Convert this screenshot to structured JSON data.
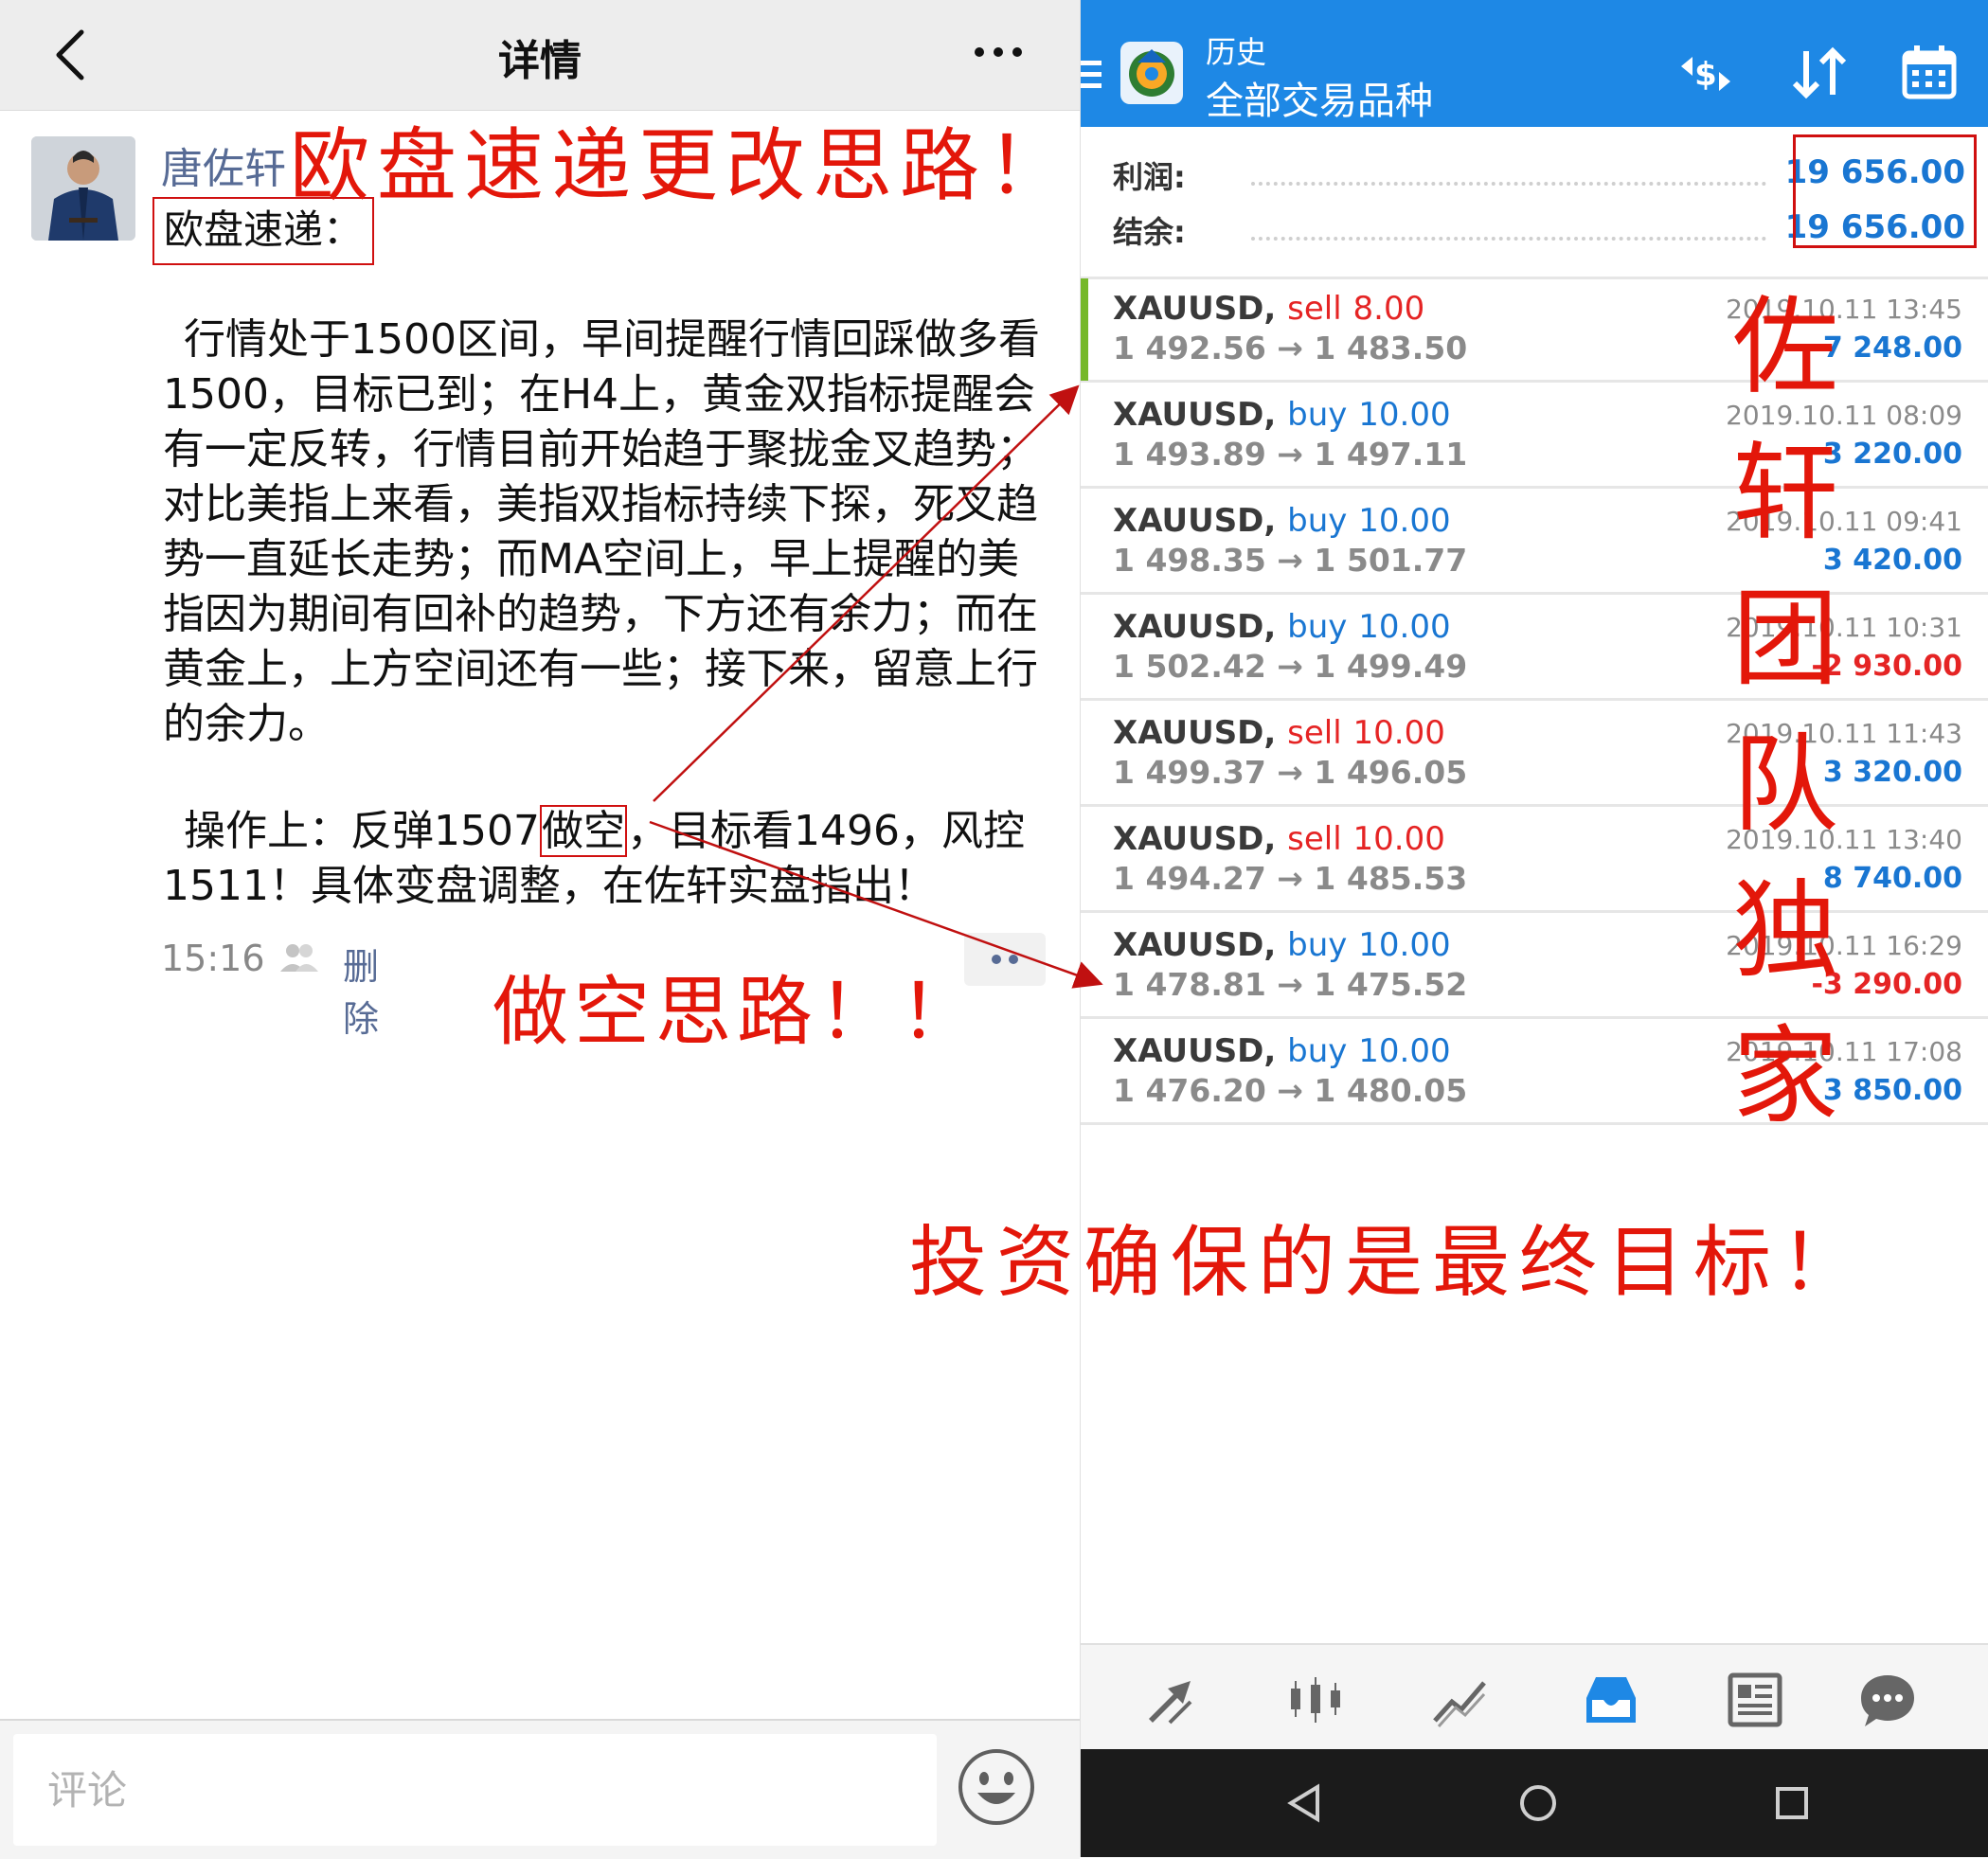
{
  "left": {
    "header": {
      "title": "详情"
    },
    "post": {
      "username": "唐佐轩",
      "heading": "欧盘速递：",
      "paragraph1": "行情处于1500区间，早间提醒行情回踩做多看1500，目标已到；在H4上，黄金双指标提醒会有一定反转，行情目前开始趋于聚拢金叉趋势；对比美指上来看，美指双指标持续下探，死叉趋势一直延长走势；而MA空间上，早上提醒的美指因为期间有回补的趋势，下方还有余力；而在黄金上，上方空间还有一些；接下来，留意上行的余力。",
      "paragraph2_before": "操作上：反弹1507",
      "paragraph2_highlight": "做空",
      "paragraph2_after": "，目标看1496，风控1511！具体变盘调整，在佐轩实盘指出！",
      "time": "15:16",
      "delete_label": "删除"
    },
    "comment": {
      "placeholder": "评论"
    }
  },
  "right": {
    "header": {
      "title": "历史",
      "subtitle": "全部交易品种"
    },
    "summary": {
      "profit_label": "利润:",
      "profit_value": "19 656.00",
      "balance_label": "结余:",
      "balance_value": "19 656.00"
    },
    "trades": [
      {
        "symbol": "XAUUSD,",
        "side": "sell",
        "volume": "8.00",
        "prices": "1 492.56 → 1 483.50",
        "time": "2019.10.11 13:45",
        "profit": "7 248.00"
      },
      {
        "symbol": "XAUUSD,",
        "side": "buy",
        "volume": "10.00",
        "prices": "1 493.89 → 1 497.11",
        "time": "2019.10.11 08:09",
        "profit": "3 220.00"
      },
      {
        "symbol": "XAUUSD,",
        "side": "buy",
        "volume": "10.00",
        "prices": "1 498.35 → 1 501.77",
        "time": "2019.10.11 09:41",
        "profit": "3 420.00"
      },
      {
        "symbol": "XAUUSD,",
        "side": "buy",
        "volume": "10.00",
        "prices": "1 502.42 → 1 499.49",
        "time": "2019.10.11 10:31",
        "profit": "-2 930.00"
      },
      {
        "symbol": "XAUUSD,",
        "side": "sell",
        "volume": "10.00",
        "prices": "1 499.37 → 1 496.05",
        "time": "2019.10.11 11:43",
        "profit": "3 320.00"
      },
      {
        "symbol": "XAUUSD,",
        "side": "sell",
        "volume": "10.00",
        "prices": "1 494.27 → 1 485.53",
        "time": "2019.10.11 13:40",
        "profit": "8 740.00"
      },
      {
        "symbol": "XAUUSD,",
        "side": "buy",
        "volume": "10.00",
        "prices": "1 478.81 → 1 475.52",
        "time": "2019.10.11 16:29",
        "profit": "-3 290.00"
      },
      {
        "symbol": "XAUUSD,",
        "side": "buy",
        "volume": "10.00",
        "prices": "1 476.20 → 1 480.05",
        "time": "2019.10.11 17:08",
        "profit": "3 850.00"
      }
    ],
    "bottom_nav": [
      "trade-arrows-icon",
      "quotes-icon",
      "chart-icon",
      "history-inbox-icon",
      "news-icon",
      "chat-icon"
    ]
  },
  "annotations": {
    "title": "欧盘速递更改思路！",
    "short_idea": "做空思路！！",
    "team": "佐轩团队独家",
    "goal": "投资确保的是最终目标！"
  },
  "colors": {
    "accent_blue": "#1e88e5",
    "profit_blue": "#1976d2",
    "loss_red": "#e52424",
    "annotation_red": "#e3170a",
    "link_blue": "#576b95",
    "active_bar_green": "#76b82a"
  }
}
